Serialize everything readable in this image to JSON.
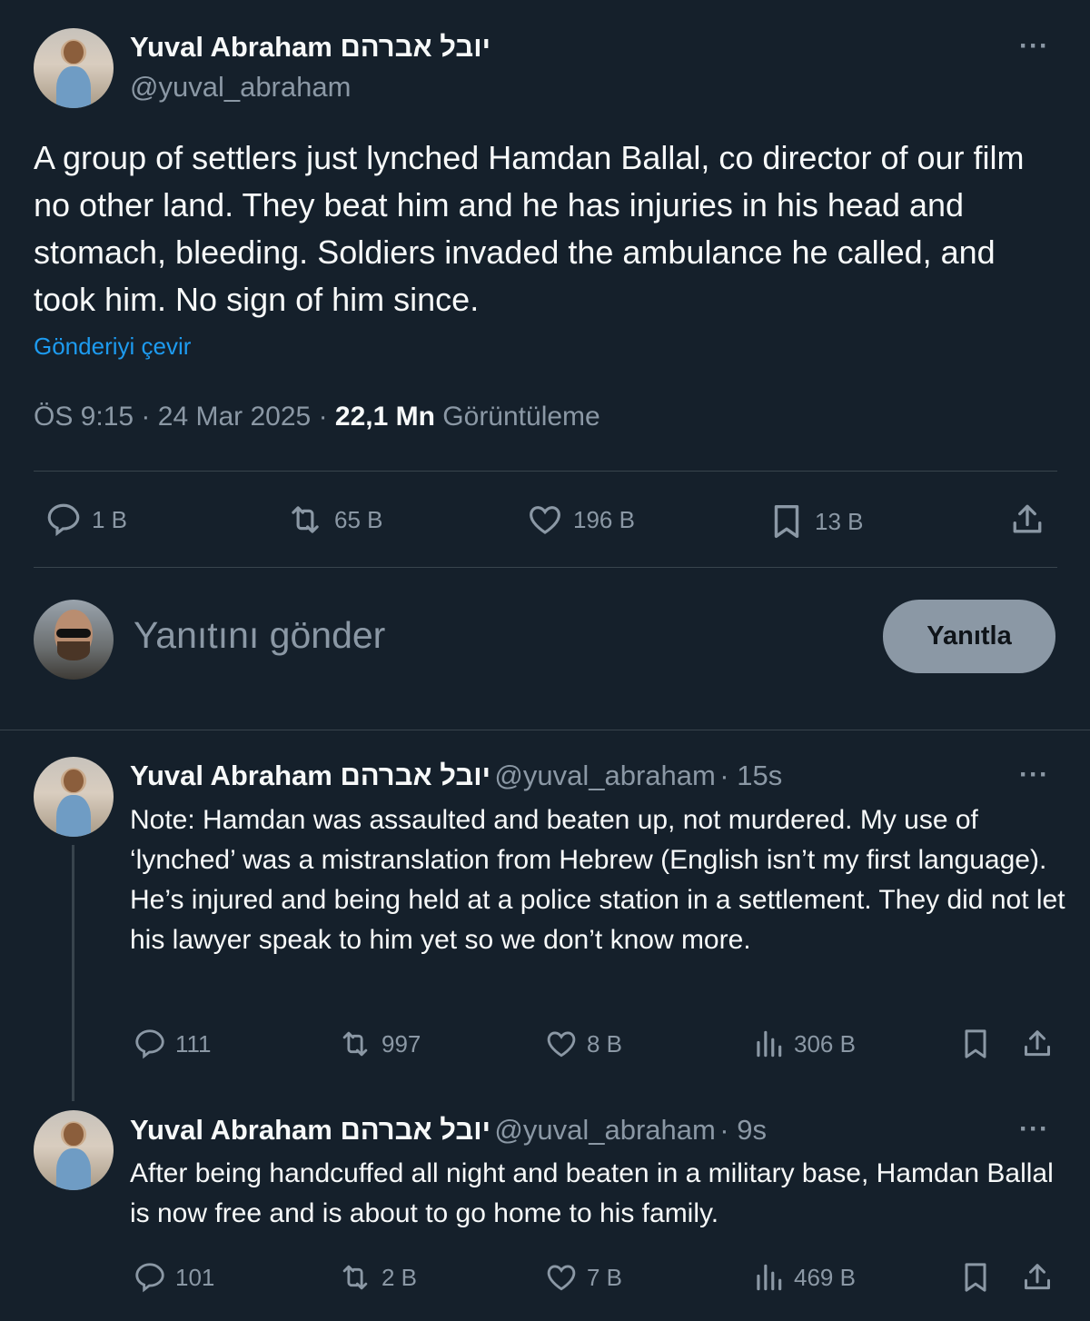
{
  "main_tweet": {
    "author_name": "Yuval Abraham יובל אברהם",
    "author_handle": "@yuval_abraham",
    "more": "···",
    "text": "A group of settlers just lynched Hamdan Ballal, co director of our film no other land. They beat him and he has injuries in his head and stomach, bleeding. Soldiers invaded the ambulance he called, and took him. No sign of him since.",
    "translate_link": "Gönderiyi çevir",
    "time": "ÖS 9:15",
    "date": "24 Mar 2025",
    "views_count": "22,1 Mn",
    "views_label": "Görüntüleme",
    "separator": "·",
    "actions": {
      "replies": "1 B",
      "retweets": "65 B",
      "likes": "196 B",
      "bookmarks": "13 B"
    }
  },
  "compose": {
    "placeholder": "Yanıtını gönder",
    "button_label": "Yanıtla"
  },
  "replies": [
    {
      "author_name": "Yuval Abraham יובל אברהם",
      "author_handle": "@yuval_abraham",
      "time": "· 15s",
      "more": "···",
      "text": "Note: Hamdan was assaulted and beaten up, not murdered. My use of ‘lynched’ was a mistranslation from Hebrew (English isn’t my first language). He’s injured and being held at a police station in a settlement. They did not let his lawyer speak to him yet so we don’t know more.",
      "replies": "111",
      "retweets": "997",
      "likes": "8 B",
      "views": "306 B"
    },
    {
      "author_name": "Yuval Abraham יובל אברהם",
      "author_handle": "@yuval_abraham",
      "time": "· 9s",
      "more": "···",
      "text": "After being handcuffed all night and beaten in a military base, Hamdan Ballal is now free and is about to go home to his family.",
      "replies": "101",
      "retweets": "2 B",
      "likes": "7 B",
      "views": "469 B"
    }
  ],
  "colors": {
    "background": "#15202b",
    "text_primary": "#f7f9f9",
    "text_secondary": "#8b98a5",
    "link": "#1d9bf0",
    "divider": "#38444d"
  }
}
